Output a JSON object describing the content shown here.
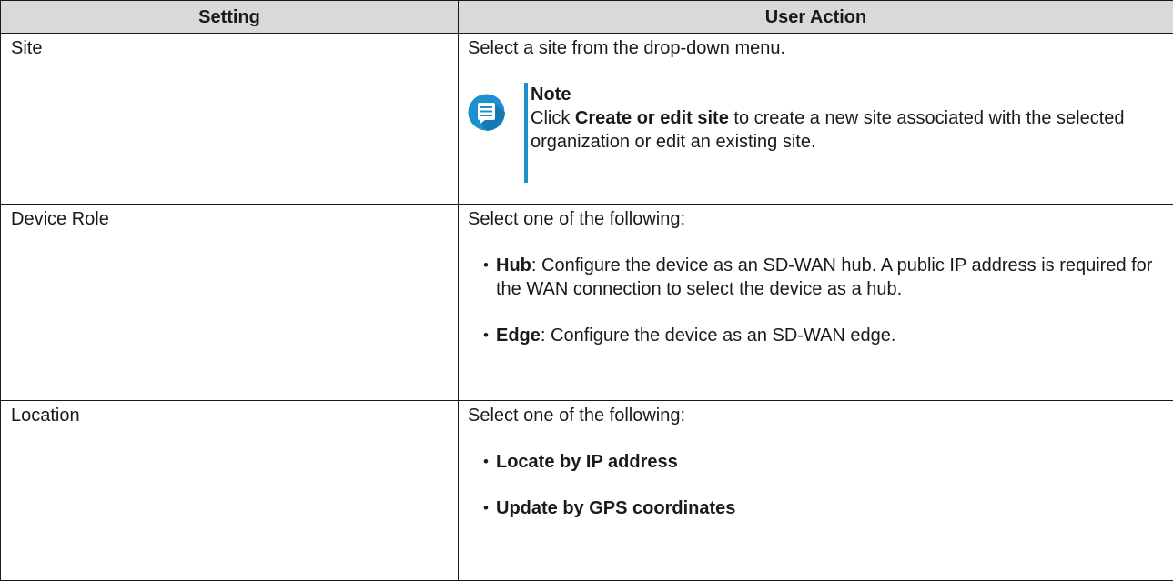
{
  "header": {
    "col_setting": "Setting",
    "col_action": "User Action"
  },
  "rows": [
    {
      "setting": "Site",
      "action_text": "Select a site from the drop-down menu.",
      "note": {
        "icon": "note-icon",
        "title": "Note",
        "pre": "Click ",
        "bold": "Create or edit site",
        "post": " to create a new site associated with the selected organization or edit an existing site."
      }
    },
    {
      "setting": "Device Role",
      "action_text": "Select one of the following:",
      "items": [
        {
          "bold": "Hub",
          "text": ": Configure the device as an SD-WAN hub. A public IP address is required for the WAN connection to select the device as a hub."
        },
        {
          "bold": "Edge",
          "text": ": Configure the device as an SD-WAN edge."
        }
      ]
    },
    {
      "setting": "Location",
      "action_text": "Select one of the following:",
      "items": [
        {
          "bold": "Locate by IP address",
          "text": ""
        },
        {
          "bold": "Update by GPS coordinates",
          "text": ""
        }
      ]
    }
  ],
  "colors": {
    "header_bg": "#d9d9d9",
    "note_accent": "#1e8fcf"
  }
}
